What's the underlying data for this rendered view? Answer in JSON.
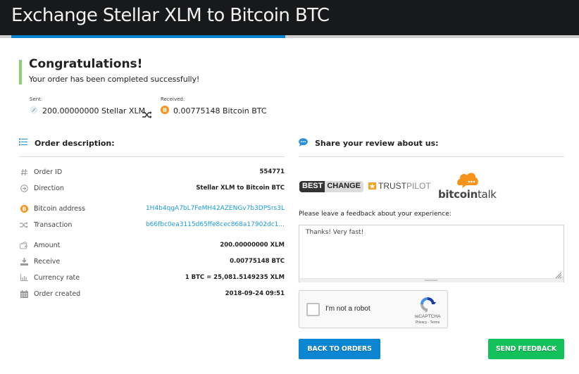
{
  "header": {
    "title": "Exchange Stellar XLM to Bitcoin BTC"
  },
  "colors": {
    "accent_blue": "#0a84cf",
    "success_green": "#8bd16f",
    "button_blue": "#0b86d2",
    "button_green": "#12c15a",
    "link_blue": "#1a9ad6",
    "bitcoin_orange": "#f7931a"
  },
  "status": {
    "title": "Congratulations!",
    "subtitle": "Your order has been completed successfully!"
  },
  "summary": {
    "sent_label": "Sent:",
    "sent_value": "200.00000000 Stellar XLM",
    "sent_icon": "stellar-rocket-icon",
    "swap_icon": "shuffle-icon",
    "received_label": "Received:",
    "received_value": "0.00775148 Bitcoin BTC",
    "received_icon": "bitcoin-icon"
  },
  "order": {
    "heading": "Order description:",
    "heading_icon": "list-icon",
    "rows": [
      {
        "icon": "hash-icon",
        "label": "Order ID",
        "value": "554771"
      },
      {
        "icon": "arrow-circle-right-icon",
        "label": "Direction",
        "value": "Stellar XLM to Bitcoin BTC"
      },
      {
        "icon": "bitcoin-icon",
        "label": "Bitcoin address",
        "value": "1H4b4qgA7bL7FeMH42AZENGv7b3DPSrs3L"
      },
      {
        "icon": "shuffle-icon",
        "label": "Transaction",
        "value": "b66fbc0ea3115d65ffe8cec868a17902dc1..."
      },
      {
        "icon": "wallet-icon",
        "label": "Amount",
        "value": "200.00000000 XLM"
      },
      {
        "icon": "download-icon",
        "label": "Receive",
        "value": "0.00775148 BTC"
      },
      {
        "icon": "bar-chart-icon",
        "label": "Currency rate",
        "value": "1 BTC = 25,081.5149235 XLM"
      },
      {
        "icon": "calendar-icon",
        "label": "Order created",
        "value": "2018-09-24 09:51"
      }
    ]
  },
  "review": {
    "heading": "Share your review about us:",
    "heading_icon": "chat-bubble-icon",
    "logos": {
      "bestchange_a": "BEST",
      "bestchange_b": "CHANGE",
      "trustpilot_a": "TRUST",
      "trustpilot_b": "PILOT",
      "bitcointalk_a": "bitcoin",
      "bitcointalk_b": "talk"
    },
    "feedback_label": "Please leave a feedback about your experience:",
    "feedback_value": "Thanks! Very fast!"
  },
  "captcha": {
    "label": "I'm not a robot",
    "brand": "reCAPTCHA",
    "links": "Privacy - Terms"
  },
  "buttons": {
    "back": "BACK TO ORDERS",
    "send": "SEND FEEDBACK"
  }
}
